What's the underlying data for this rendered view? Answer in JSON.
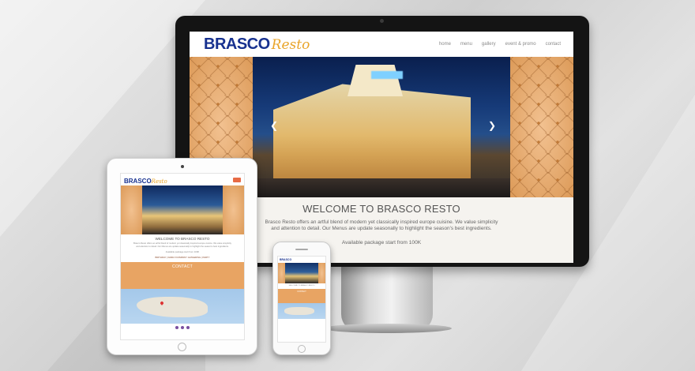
{
  "brand": {
    "name_bold": "BRASCO",
    "name_script": "Resto"
  },
  "nav": {
    "items": [
      "home",
      "menu",
      "gallery",
      "event & promo",
      "contact"
    ]
  },
  "hero": {
    "prev_icon": "chevron-left-icon",
    "next_icon": "chevron-right-icon"
  },
  "welcome": {
    "title": "WELCOME TO BRASCO RESTO",
    "line1": "Brasco Resto offers an artful blend of modern yet classically inspired europe cuisine. We value simplicity",
    "line2": "and attention to detail. Our Menus are update seasonally to highlight the season's best ingredients.",
    "package": "Available package start from 100K"
  },
  "tablet": {
    "welcome_title": "WELCOME TO BRASCO RESTO",
    "links": "BIRTHDAY  |  FAMILY/COMPANY GATHERING  |  PARTY",
    "contact_title": "CONTACT"
  },
  "colors": {
    "brand_blue": "#17318f",
    "brand_gold": "#e9a52a",
    "contact_band": "#e8a463",
    "menu_button": "#e76b45"
  }
}
